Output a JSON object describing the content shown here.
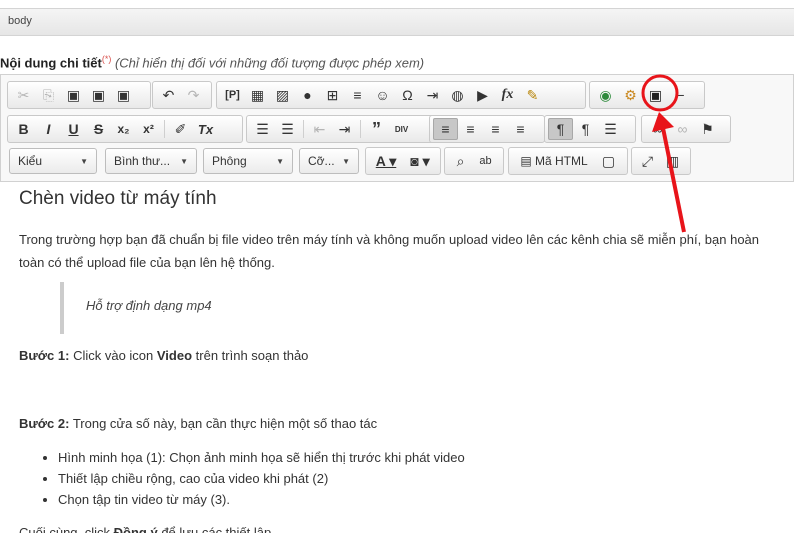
{
  "topbar": {
    "label": "body"
  },
  "field": {
    "label": "Nội dung chi tiết",
    "required": "(*)",
    "note": "(Chỉ hiển thị đối với những đối tượng được phép xem)"
  },
  "toolbar": {
    "row1": [
      {
        "name": "cut-icon",
        "glyph": "✂",
        "disabled": true
      },
      {
        "name": "copy-icon",
        "glyph": "⎘",
        "disabled": true
      },
      {
        "name": "paste-icon",
        "glyph": "📋"
      },
      {
        "name": "paste-text-icon",
        "glyph": "📋"
      },
      {
        "name": "paste-word-icon",
        "glyph": "📋"
      },
      {
        "name": "undo-icon",
        "glyph": "↶"
      },
      {
        "name": "redo-icon",
        "glyph": "↷",
        "disabled": true
      },
      {
        "name": "paragraph-icon",
        "glyph": "[P]"
      },
      {
        "name": "template-icon",
        "glyph": "▦"
      },
      {
        "name": "image-icon",
        "glyph": "🖼"
      },
      {
        "name": "flash-icon",
        "glyph": "●"
      },
      {
        "name": "table-icon",
        "glyph": "⊞"
      },
      {
        "name": "horizontal-rule-icon",
        "glyph": "≡"
      },
      {
        "name": "smiley-icon",
        "glyph": "☺"
      },
      {
        "name": "omega-icon",
        "glyph": "Ω"
      },
      {
        "name": "page-break-icon",
        "glyph": "⇥"
      },
      {
        "name": "iframe-icon",
        "glyph": "◍"
      },
      {
        "name": "youtube-icon",
        "glyph": "▶"
      },
      {
        "name": "formula-icon",
        "glyph": "fx"
      },
      {
        "name": "spellcheck-icon",
        "glyph": "✎"
      },
      {
        "name": "globe-icon",
        "glyph": "🌍"
      },
      {
        "name": "plugin-icon",
        "glyph": "⚙"
      },
      {
        "name": "video-icon",
        "glyph": "🎬"
      },
      {
        "name": "minimize-icon",
        "glyph": "−"
      }
    ],
    "row2": [
      {
        "name": "bold-icon",
        "glyph": "B"
      },
      {
        "name": "italic-icon",
        "glyph": "I"
      },
      {
        "name": "underline-icon",
        "glyph": "U"
      },
      {
        "name": "strike-icon",
        "glyph": "S"
      },
      {
        "name": "subscript-icon",
        "glyph": "x₂"
      },
      {
        "name": "superscript-icon",
        "glyph": "x²"
      },
      {
        "name": "format-painter-icon",
        "glyph": "🖌"
      },
      {
        "name": "clear-format-icon",
        "glyph": "Tx"
      },
      {
        "name": "numbered-list-icon",
        "glyph": "⒈"
      },
      {
        "name": "bulleted-list-icon",
        "glyph": "•≡"
      },
      {
        "name": "outdent-icon",
        "glyph": "⇤",
        "disabled": true
      },
      {
        "name": "indent-icon",
        "glyph": "⇥"
      },
      {
        "name": "blockquote-icon",
        "glyph": "❞"
      },
      {
        "name": "div-icon",
        "glyph": "DIV"
      },
      {
        "name": "align-left-icon",
        "glyph": "≡",
        "active": true
      },
      {
        "name": "align-center-icon",
        "glyph": "≡"
      },
      {
        "name": "align-right-icon",
        "glyph": "≡"
      },
      {
        "name": "justify-icon",
        "glyph": "≡"
      },
      {
        "name": "ltr-icon",
        "glyph": "¶",
        "active": true
      },
      {
        "name": "rtl-icon",
        "glyph": "¶"
      },
      {
        "name": "language-icon",
        "glyph": "Ⅲ"
      },
      {
        "name": "link-icon",
        "glyph": "🔗"
      },
      {
        "name": "unlink-icon",
        "glyph": "⛓",
        "disabled": true
      },
      {
        "name": "anchor-icon",
        "glyph": "⚑"
      }
    ],
    "combos": [
      {
        "name": "style-select",
        "label": "Kiểu"
      },
      {
        "name": "format-select",
        "label": "Bình thư..."
      },
      {
        "name": "font-select",
        "label": "Phông"
      },
      {
        "name": "size-select",
        "label": "Cỡ..."
      }
    ],
    "row3": [
      {
        "name": "text-color-icon",
        "glyph": "A"
      },
      {
        "name": "bg-color-icon",
        "glyph": "A"
      },
      {
        "name": "find-icon",
        "glyph": "🔍"
      },
      {
        "name": "replace-icon",
        "glyph": "ab"
      },
      {
        "name": "source-icon",
        "glyph": "▤",
        "label": "Mã HTML"
      },
      {
        "name": "preview-icon",
        "glyph": "▢"
      },
      {
        "name": "maximize-icon",
        "glyph": "⤢"
      },
      {
        "name": "show-blocks-icon",
        "glyph": "▥"
      }
    ]
  },
  "content": {
    "heading": "Chèn video từ máy tính",
    "para1_line1": "Trong trường hợp bạn đã chuẩn bị file video trên máy tính và không muốn upload video lên các kênh chia sẽ miễn phí, bạn hoàn",
    "para1_line2": "toàn có thể upload file của bạn lên hệ thống.",
    "quote": "Hỗ trợ định dạng mp4",
    "step1_label": "Bước 1:",
    "step1_text_a": " Click vào icon ",
    "step1_bold": "Video",
    "step1_text_b": " trên trình soạn thảo",
    "step2_label": "Bước 2:",
    "step2_text": " Trong cửa số này, bạn cần thực hiện một số thao tác",
    "list": [
      "Hình minh họa (1): Chọn ảnh minh họa sẽ hiển thị trước khi phát video",
      "Thiết lập chiều rộng, cao của video khi phát (2)",
      "Chọn tập tin video từ máy (3)."
    ],
    "final_a": "Cuối cùng, click ",
    "final_bold": "Đồng ý",
    "final_b": " để lưu các thiết lập"
  },
  "colors": {
    "annotation": "#e8141a"
  }
}
